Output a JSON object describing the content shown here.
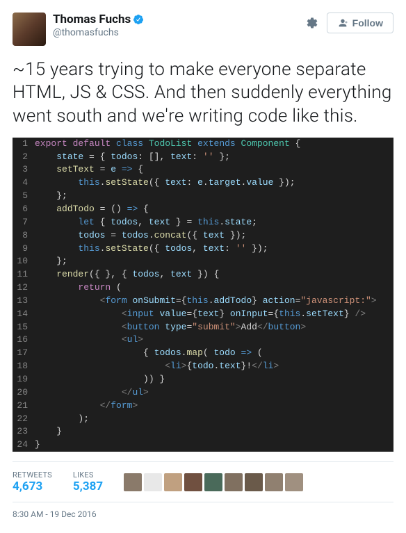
{
  "user": {
    "display_name": "Thomas Fuchs",
    "handle": "@thomasfuchs",
    "verified": true
  },
  "actions": {
    "follow_label": "Follow"
  },
  "tweet_text": "~15 years trying to make everyone separate HTML, JS & CSS. And then suddenly everything went south and we're writing code like this.",
  "code": {
    "lines": [
      {
        "n": "1",
        "tokens": [
          [
            "k",
            "export"
          ],
          [
            "txt",
            " "
          ],
          [
            "k",
            "default"
          ],
          [
            "txt",
            " "
          ],
          [
            "th",
            "class"
          ],
          [
            "txt",
            " "
          ],
          [
            "cls",
            "TodoList"
          ],
          [
            "txt",
            " "
          ],
          [
            "th",
            "extends"
          ],
          [
            "txt",
            " "
          ],
          [
            "cls",
            "Component"
          ],
          [
            "txt",
            " {"
          ]
        ]
      },
      {
        "n": "2",
        "tokens": [
          [
            "txt",
            "    "
          ],
          [
            "id",
            "state"
          ],
          [
            "txt",
            " = { "
          ],
          [
            "id",
            "todos"
          ],
          [
            "txt",
            ": [], "
          ],
          [
            "id",
            "text"
          ],
          [
            "txt",
            ": "
          ],
          [
            "s",
            "''"
          ],
          [
            "txt",
            " };"
          ]
        ]
      },
      {
        "n": "3",
        "tokens": [
          [
            "txt",
            "    "
          ],
          [
            "fn",
            "setText"
          ],
          [
            "txt",
            " = "
          ],
          [
            "id",
            "e"
          ],
          [
            "txt",
            " "
          ],
          [
            "th",
            "=>"
          ],
          [
            "txt",
            " {"
          ]
        ]
      },
      {
        "n": "4",
        "tokens": [
          [
            "txt",
            "        "
          ],
          [
            "th",
            "this"
          ],
          [
            "txt",
            "."
          ],
          [
            "fn",
            "setState"
          ],
          [
            "txt",
            "({ "
          ],
          [
            "id",
            "text"
          ],
          [
            "txt",
            ": "
          ],
          [
            "id",
            "e"
          ],
          [
            "txt",
            "."
          ],
          [
            "id",
            "target"
          ],
          [
            "txt",
            "."
          ],
          [
            "id",
            "value"
          ],
          [
            "txt",
            " });"
          ]
        ]
      },
      {
        "n": "5",
        "tokens": [
          [
            "txt",
            "    };"
          ]
        ]
      },
      {
        "n": "6",
        "tokens": [
          [
            "txt",
            "    "
          ],
          [
            "fn",
            "addTodo"
          ],
          [
            "txt",
            " = () "
          ],
          [
            "th",
            "=>"
          ],
          [
            "txt",
            " {"
          ]
        ]
      },
      {
        "n": "7",
        "tokens": [
          [
            "txt",
            "        "
          ],
          [
            "th",
            "let"
          ],
          [
            "txt",
            " { "
          ],
          [
            "id",
            "todos"
          ],
          [
            "txt",
            ", "
          ],
          [
            "id",
            "text"
          ],
          [
            "txt",
            " } = "
          ],
          [
            "th",
            "this"
          ],
          [
            "txt",
            "."
          ],
          [
            "id",
            "state"
          ],
          [
            "txt",
            ";"
          ]
        ]
      },
      {
        "n": "8",
        "tokens": [
          [
            "txt",
            "        "
          ],
          [
            "id",
            "todos"
          ],
          [
            "txt",
            " = "
          ],
          [
            "id",
            "todos"
          ],
          [
            "txt",
            "."
          ],
          [
            "fn",
            "concat"
          ],
          [
            "txt",
            "({ "
          ],
          [
            "id",
            "text"
          ],
          [
            "txt",
            " });"
          ]
        ]
      },
      {
        "n": "9",
        "tokens": [
          [
            "txt",
            "        "
          ],
          [
            "th",
            "this"
          ],
          [
            "txt",
            "."
          ],
          [
            "fn",
            "setState"
          ],
          [
            "txt",
            "({ "
          ],
          [
            "id",
            "todos"
          ],
          [
            "txt",
            ", "
          ],
          [
            "id",
            "text"
          ],
          [
            "txt",
            ": "
          ],
          [
            "s",
            "''"
          ],
          [
            "txt",
            " });"
          ]
        ]
      },
      {
        "n": "10",
        "tokens": [
          [
            "txt",
            "    };"
          ]
        ]
      },
      {
        "n": "11",
        "tokens": [
          [
            "txt",
            "    "
          ],
          [
            "fn",
            "render"
          ],
          [
            "txt",
            "({ }, { "
          ],
          [
            "id",
            "todos"
          ],
          [
            "txt",
            ", "
          ],
          [
            "id",
            "text"
          ],
          [
            "txt",
            " }) {"
          ]
        ]
      },
      {
        "n": "12",
        "tokens": [
          [
            "txt",
            "        "
          ],
          [
            "k",
            "return"
          ],
          [
            "txt",
            " ("
          ]
        ]
      },
      {
        "n": "13",
        "tokens": [
          [
            "txt",
            "            "
          ],
          [
            "tag",
            "<"
          ],
          [
            "tagname",
            "form"
          ],
          [
            "txt",
            " "
          ],
          [
            "attr",
            "onSubmit"
          ],
          [
            "txt",
            "={"
          ],
          [
            "th",
            "this"
          ],
          [
            "txt",
            "."
          ],
          [
            "id",
            "addTodo"
          ],
          [
            "txt",
            "} "
          ],
          [
            "attr",
            "action"
          ],
          [
            "txt",
            "="
          ],
          [
            "s",
            "\"javascript:\""
          ],
          [
            "tag",
            ">"
          ]
        ]
      },
      {
        "n": "14",
        "tokens": [
          [
            "txt",
            "                "
          ],
          [
            "tag",
            "<"
          ],
          [
            "tagname",
            "input"
          ],
          [
            "txt",
            " "
          ],
          [
            "attr",
            "value"
          ],
          [
            "txt",
            "={"
          ],
          [
            "id",
            "text"
          ],
          [
            "txt",
            "} "
          ],
          [
            "attr",
            "onInput"
          ],
          [
            "txt",
            "={"
          ],
          [
            "th",
            "this"
          ],
          [
            "txt",
            "."
          ],
          [
            "id",
            "setText"
          ],
          [
            "txt",
            "} "
          ],
          [
            "tag",
            "/>"
          ]
        ]
      },
      {
        "n": "15",
        "tokens": [
          [
            "txt",
            "                "
          ],
          [
            "tag",
            "<"
          ],
          [
            "tagname",
            "button"
          ],
          [
            "txt",
            " "
          ],
          [
            "attr",
            "type"
          ],
          [
            "txt",
            "="
          ],
          [
            "s",
            "\"submit\""
          ],
          [
            "tag",
            ">"
          ],
          [
            "txt",
            "Add"
          ],
          [
            "tag",
            "</"
          ],
          [
            "tagname",
            "button"
          ],
          [
            "tag",
            ">"
          ]
        ]
      },
      {
        "n": "16",
        "tokens": [
          [
            "txt",
            "                "
          ],
          [
            "tag",
            "<"
          ],
          [
            "tagname",
            "ul"
          ],
          [
            "tag",
            ">"
          ]
        ]
      },
      {
        "n": "17",
        "tokens": [
          [
            "txt",
            "                    { "
          ],
          [
            "id",
            "todos"
          ],
          [
            "txt",
            "."
          ],
          [
            "fn",
            "map"
          ],
          [
            "txt",
            "( "
          ],
          [
            "id",
            "todo"
          ],
          [
            "txt",
            " "
          ],
          [
            "th",
            "=>"
          ],
          [
            "txt",
            " ("
          ]
        ]
      },
      {
        "n": "18",
        "tokens": [
          [
            "txt",
            "                        "
          ],
          [
            "tag",
            "<"
          ],
          [
            "tagname",
            "li"
          ],
          [
            "tag",
            ">"
          ],
          [
            "txt",
            "{"
          ],
          [
            "id",
            "todo"
          ],
          [
            "txt",
            "."
          ],
          [
            "id",
            "text"
          ],
          [
            "txt",
            "}!"
          ],
          [
            "tag",
            "</"
          ],
          [
            "tagname",
            "li"
          ],
          [
            "tag",
            ">"
          ]
        ]
      },
      {
        "n": "19",
        "tokens": [
          [
            "txt",
            "                    )) }"
          ]
        ]
      },
      {
        "n": "20",
        "tokens": [
          [
            "txt",
            "                "
          ],
          [
            "tag",
            "</"
          ],
          [
            "tagname",
            "ul"
          ],
          [
            "tag",
            ">"
          ]
        ]
      },
      {
        "n": "21",
        "tokens": [
          [
            "txt",
            "            "
          ],
          [
            "tag",
            "</"
          ],
          [
            "tagname",
            "form"
          ],
          [
            "tag",
            ">"
          ]
        ]
      },
      {
        "n": "22",
        "tokens": [
          [
            "txt",
            "        );"
          ]
        ]
      },
      {
        "n": "23",
        "tokens": [
          [
            "txt",
            "    }"
          ]
        ]
      },
      {
        "n": "24",
        "tokens": [
          [
            "txt",
            "}"
          ]
        ]
      }
    ]
  },
  "stats": {
    "retweets_label": "RETWEETS",
    "retweets_value": "4,673",
    "likes_label": "LIKES",
    "likes_value": "5,387"
  },
  "liker_colors": [
    "#8a7a6a",
    "#e8e8e8",
    "#c0a080",
    "#705040",
    "#4a6a5a",
    "#807060",
    "#6a5a4a",
    "#908070",
    "#a09080"
  ],
  "timestamp": "8:30 AM - 19 Dec 2016"
}
